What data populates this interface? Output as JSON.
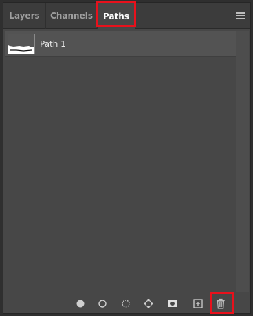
{
  "tabs": [
    {
      "label": "Layers"
    },
    {
      "label": "Channels"
    },
    {
      "label": "Paths"
    }
  ],
  "active_tab": "Paths",
  "paths": [
    {
      "name": "Path 1"
    }
  ],
  "footer_icons": [
    "fill-path-icon",
    "stroke-path-icon",
    "load-path-as-selection-icon",
    "make-work-path-icon",
    "add-mask-icon",
    "create-new-path-icon",
    "delete-path-icon"
  ],
  "colors": {
    "panel_bg": "#474747",
    "tab_bar_bg": "#3c3c3c",
    "highlight": "#e8111c"
  }
}
